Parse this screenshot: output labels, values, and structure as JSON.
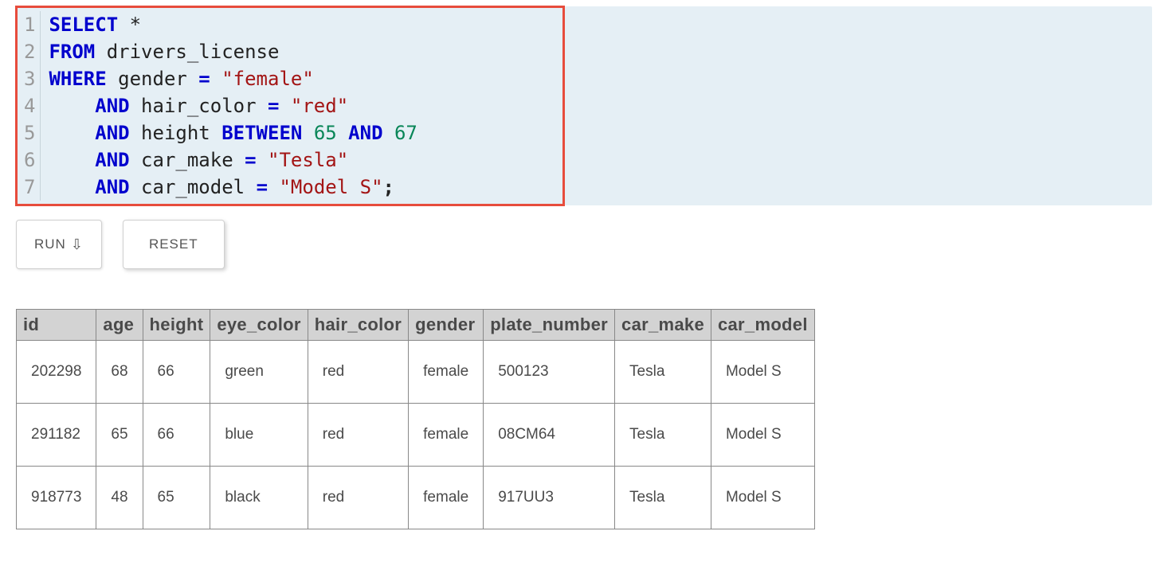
{
  "editor": {
    "lines": [
      [
        {
          "t": "SELECT",
          "c": "kw"
        },
        {
          "t": " ",
          "c": "ident"
        },
        {
          "t": "*",
          "c": "star"
        }
      ],
      [
        {
          "t": "FROM",
          "c": "kw"
        },
        {
          "t": " drivers_license",
          "c": "ident"
        }
      ],
      [
        {
          "t": "WHERE",
          "c": "kw"
        },
        {
          "t": " gender ",
          "c": "ident"
        },
        {
          "t": "=",
          "c": "op"
        },
        {
          "t": " ",
          "c": "ident"
        },
        {
          "t": "\"female\"",
          "c": "str"
        }
      ],
      [
        {
          "t": "    ",
          "c": "ident"
        },
        {
          "t": "AND",
          "c": "kw"
        },
        {
          "t": " hair_color ",
          "c": "ident"
        },
        {
          "t": "=",
          "c": "op"
        },
        {
          "t": " ",
          "c": "ident"
        },
        {
          "t": "\"red\"",
          "c": "str"
        }
      ],
      [
        {
          "t": "    ",
          "c": "ident"
        },
        {
          "t": "AND",
          "c": "kw"
        },
        {
          "t": " height ",
          "c": "ident"
        },
        {
          "t": "BETWEEN",
          "c": "kw"
        },
        {
          "t": " ",
          "c": "ident"
        },
        {
          "t": "65",
          "c": "num"
        },
        {
          "t": " ",
          "c": "ident"
        },
        {
          "t": "AND",
          "c": "kw"
        },
        {
          "t": " ",
          "c": "ident"
        },
        {
          "t": "67",
          "c": "num"
        }
      ],
      [
        {
          "t": "    ",
          "c": "ident"
        },
        {
          "t": "AND",
          "c": "kw"
        },
        {
          "t": " car_make ",
          "c": "ident"
        },
        {
          "t": "=",
          "c": "op"
        },
        {
          "t": " ",
          "c": "ident"
        },
        {
          "t": "\"Tesla\"",
          "c": "str"
        }
      ],
      [
        {
          "t": "    ",
          "c": "ident"
        },
        {
          "t": "AND",
          "c": "kw"
        },
        {
          "t": " car_model ",
          "c": "ident"
        },
        {
          "t": "=",
          "c": "op"
        },
        {
          "t": " ",
          "c": "ident"
        },
        {
          "t": "\"Model S\"",
          "c": "str"
        },
        {
          "t": ";",
          "c": "punct"
        }
      ]
    ],
    "line_numbers": [
      "1",
      "2",
      "3",
      "4",
      "5",
      "6",
      "7"
    ]
  },
  "buttons": {
    "run": "RUN",
    "run_arrow": "⇩",
    "reset": "RESET"
  },
  "results": {
    "headers": [
      "id",
      "age",
      "height",
      "eye_color",
      "hair_color",
      "gender",
      "plate_number",
      "car_make",
      "car_model"
    ],
    "rows": [
      [
        "202298",
        "68",
        "66",
        "green",
        "red",
        "female",
        "500123",
        "Tesla",
        "Model S"
      ],
      [
        "291182",
        "65",
        "66",
        "blue",
        "red",
        "female",
        "08CM64",
        "Tesla",
        "Model S"
      ],
      [
        "918773",
        "48",
        "65",
        "black",
        "red",
        "female",
        "917UU3",
        "Tesla",
        "Model S"
      ]
    ]
  }
}
